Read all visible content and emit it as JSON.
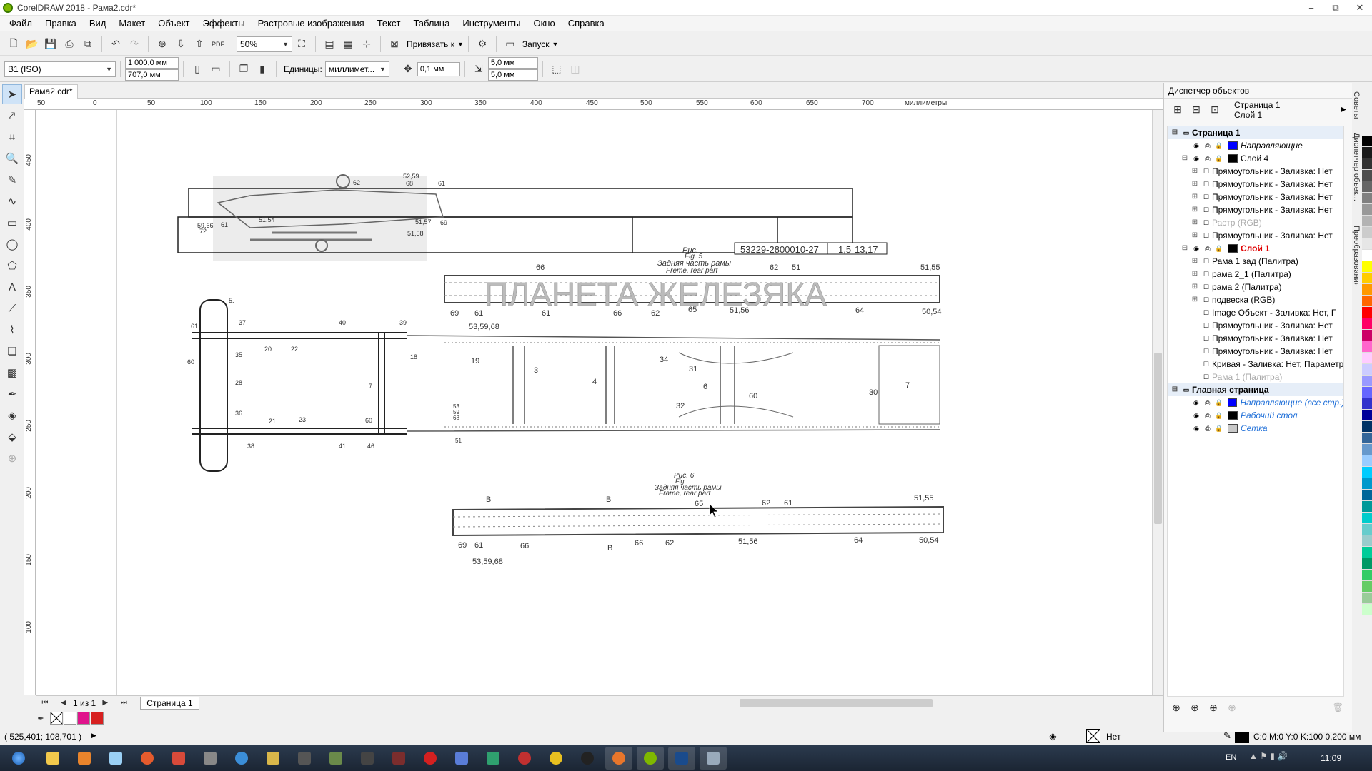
{
  "window": {
    "title": "CorelDRAW 2018 - Рама2.cdr*",
    "controls": [
      "−",
      "⧉",
      "✕"
    ]
  },
  "menu": [
    "Файл",
    "Правка",
    "Вид",
    "Макет",
    "Объект",
    "Эффекты",
    "Растровые изображения",
    "Текст",
    "Таблица",
    "Инструменты",
    "Окно",
    "Справка"
  ],
  "toolbar1": {
    "zoom": "50%",
    "snap": "Привязать к",
    "launch": "Запуск"
  },
  "toolbar2": {
    "page_size": "B1 (ISO)",
    "width": "1 000,0 мм",
    "height": "707,0 мм",
    "units_label": "Единицы:",
    "units": "миллимет...",
    "nudge": "0,1 мм",
    "dup_x": "5,0 мм",
    "dup_y": "5,0 мм"
  },
  "doc_tab": "Рама2.cdr*",
  "ruler_top": [
    "50",
    "0",
    "50",
    "100",
    "150",
    "200",
    "250",
    "300",
    "350",
    "400",
    "450",
    "500",
    "550",
    "600",
    "650",
    "700",
    "миллиметры"
  ],
  "ruler_left": [
    "450",
    "400",
    "350",
    "300",
    "250",
    "200",
    "150",
    "100"
  ],
  "drawing": {
    "title_block": {
      "code": "53229-2800010-27",
      "sheet": "1,5",
      "pages": "13,17"
    },
    "fig5": {
      "ris": "Рис.",
      "fig": "Fig. 5",
      "caption_ru": "Задняя часть рамы",
      "caption_en": "Freme, rear part"
    },
    "fig6": {
      "ris": "Рис. 6",
      "fig": "Fig.",
      "caption_ru": "Задняя часть рамы",
      "caption_en": "Frame, rear part"
    },
    "watermark": "ПЛАНЕТА ЖЕЛЕЗЯКА",
    "top_strip_labels": {
      "a": "52,59",
      "b": "68",
      "c": "61",
      "d": "62",
      "e": "59,66",
      "f": "72",
      "g": "51,54",
      "h": "61",
      "i": "51,57",
      "j": "51,58",
      "k": "69"
    },
    "rear1_labels": {
      "n66": "66",
      "n62": "62",
      "n51": "51",
      "n5155": "51,55",
      "n69": "69",
      "n61a": "61",
      "n61b": "61",
      "n66b": "66",
      "n62b": "62",
      "n65": "65",
      "n5156": "51,56",
      "n64": "64",
      "n5054": "50,54"
    },
    "frame_labels": {
      "n5": "5.",
      "n37": "37",
      "n40": "40",
      "n39": "39",
      "n61": "61",
      "n35": "35",
      "n20": "20",
      "n22": "22",
      "n18": "18",
      "n60": "60",
      "n28": "28",
      "n7": "7",
      "n36": "36",
      "n21": "21",
      "n23": "23",
      "n60b": "60",
      "n38": "38",
      "n41": "41",
      "n46": "46"
    },
    "rear_frame_labels": {
      "n535968": "53,59,68",
      "n19": "19",
      "n3": "3",
      "n4": "4",
      "n34": "34",
      "n31": "31",
      "n6": "6",
      "n60": "60",
      "n32": "32",
      "n30": "30",
      "n7": "7",
      "n53": "53",
      "n59": "59",
      "n68": "68",
      "n51": "51"
    },
    "rear2_labels": {
      "B1": "B",
      "B2": "B",
      "B3": "B",
      "n65": "65",
      "n62": "62",
      "n61": "61",
      "n5155": "51,55",
      "n69": "69",
      "n61b": "61",
      "n66": "66",
      "n66b": "66",
      "n62b": "62",
      "n5156": "51,56",
      "n64": "64",
      "n5054": "50,54",
      "n535968": "53,59,68"
    }
  },
  "page_nav": {
    "counter": "1 из 1",
    "page_tab": "Страница 1"
  },
  "status": {
    "coords": "( 525,401; 108,701 )",
    "fill": "Нет",
    "outline": "C:0 M:0 Y:0 K:100  0,200 мм"
  },
  "tray": {
    "lang": "EN",
    "time": "11:09"
  },
  "object_manager": {
    "title": "Диспетчер объектов",
    "current_page": "Страница 1",
    "current_layer": "Слой 1",
    "rows": [
      {
        "indent": 0,
        "exp": "⊟",
        "name": "Страница 1",
        "type": "page"
      },
      {
        "indent": 1,
        "exp": "",
        "name": "Направляющие",
        "color": "#0000ff",
        "style": "italic"
      },
      {
        "indent": 1,
        "exp": "⊟",
        "name": "Слой 4",
        "color": "#000000"
      },
      {
        "indent": 2,
        "exp": "⊞",
        "name": "Прямоугольник - Заливка: Нет"
      },
      {
        "indent": 2,
        "exp": "⊞",
        "name": "Прямоугольник - Заливка: Нет"
      },
      {
        "indent": 2,
        "exp": "⊞",
        "name": "Прямоугольник - Заливка: Нет"
      },
      {
        "indent": 2,
        "exp": "⊞",
        "name": "Прямоугольник - Заливка: Нет"
      },
      {
        "indent": 2,
        "exp": "⊞",
        "name": "Растр (RGB)",
        "style": "grey"
      },
      {
        "indent": 2,
        "exp": "⊞",
        "name": "Прямоугольник - Заливка: Нет"
      },
      {
        "indent": 1,
        "exp": "⊟",
        "name": "Слой 1",
        "color": "#000000",
        "style": "red"
      },
      {
        "indent": 2,
        "exp": "⊞",
        "name": "Рама 1 зад (Палитра)"
      },
      {
        "indent": 2,
        "exp": "⊞",
        "name": "рама 2_1 (Палитра)"
      },
      {
        "indent": 2,
        "exp": "⊞",
        "name": "рама 2 (Палитра)"
      },
      {
        "indent": 2,
        "exp": "⊞",
        "name": "подвеска (RGB)"
      },
      {
        "indent": 2,
        "exp": "",
        "name": "Image Объект - Заливка: Нет, Г"
      },
      {
        "indent": 2,
        "exp": "",
        "name": "Прямоугольник - Заливка: Нет"
      },
      {
        "indent": 2,
        "exp": "",
        "name": "Прямоугольник - Заливка: Нет"
      },
      {
        "indent": 2,
        "exp": "",
        "name": "Прямоугольник - Заливка: Нет"
      },
      {
        "indent": 2,
        "exp": "",
        "name": "Кривая - Заливка: Нет, Параметр"
      },
      {
        "indent": 2,
        "exp": "",
        "name": "Рама 1 (Палитра)",
        "style": "grey"
      },
      {
        "indent": 0,
        "exp": "⊟",
        "name": "Главная страница",
        "type": "page"
      },
      {
        "indent": 1,
        "exp": "",
        "name": "Направляющие (все стр.)",
        "color": "#0000ff",
        "style": "blueital"
      },
      {
        "indent": 1,
        "exp": "",
        "name": "Рабочий стол",
        "color": "#000000",
        "style": "blueital"
      },
      {
        "indent": 1,
        "exp": "",
        "name": "Сетка",
        "color": "#c8c8c8",
        "style": "blueital"
      }
    ]
  },
  "side_tabs": [
    "Советы",
    "Диспетчер объек...",
    "Преобразования"
  ],
  "palette": [
    "#000000",
    "#1a1a1a",
    "#333333",
    "#4d4d4d",
    "#666666",
    "#808080",
    "#999999",
    "#b3b3b3",
    "#cccccc",
    "#e6e6e6",
    "#ffffff",
    "#ffff00",
    "#ffcc00",
    "#ff9900",
    "#ff6600",
    "#ff0000",
    "#ff0066",
    "#cc0066",
    "#ff66cc",
    "#ffccff",
    "#ccccff",
    "#9999ff",
    "#6666ff",
    "#3333cc",
    "#000099",
    "#003366",
    "#336699",
    "#6699cc",
    "#99ccff",
    "#00ccff",
    "#0099cc",
    "#006699",
    "#009999",
    "#00cccc",
    "#66cccc",
    "#99cccc",
    "#00cc99",
    "#009966",
    "#33cc66",
    "#66cc66",
    "#99cc99",
    "#ccffcc"
  ],
  "bottom_palette": [
    "#ffffff",
    "#e0138c",
    "#d72020"
  ]
}
